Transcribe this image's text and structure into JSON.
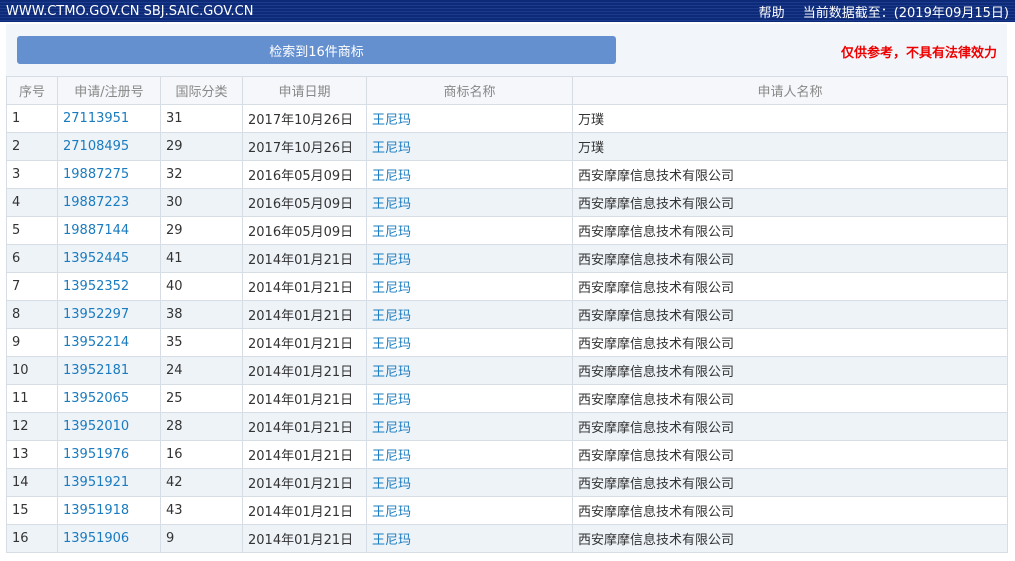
{
  "header": {
    "site": "WWW.CTMO.GOV.CN SBJ.SAIC.GOV.CN",
    "help": "帮助",
    "data_date": "当前数据截至：(2019年09月15日)"
  },
  "search_result": "检索到16件商标",
  "disclaimer": "仅供参考，不具有法律效力",
  "columns": [
    "序号",
    "申请/注册号",
    "国际分类",
    "申请日期",
    "商标名称",
    "申请人名称"
  ],
  "rows": [
    [
      "1",
      "27113951",
      "31",
      "2017年10月26日",
      "王尼玛",
      "万璞"
    ],
    [
      "2",
      "27108495",
      "29",
      "2017年10月26日",
      "王尼玛",
      "万璞"
    ],
    [
      "3",
      "19887275",
      "32",
      "2016年05月09日",
      "王尼玛",
      "西安摩摩信息技术有限公司"
    ],
    [
      "4",
      "19887223",
      "30",
      "2016年05月09日",
      "王尼玛",
      "西安摩摩信息技术有限公司"
    ],
    [
      "5",
      "19887144",
      "29",
      "2016年05月09日",
      "王尼玛",
      "西安摩摩信息技术有限公司"
    ],
    [
      "6",
      "13952445",
      "41",
      "2014年01月21日",
      "王尼玛",
      "西安摩摩信息技术有限公司"
    ],
    [
      "7",
      "13952352",
      "40",
      "2014年01月21日",
      "王尼玛",
      "西安摩摩信息技术有限公司"
    ],
    [
      "8",
      "13952297",
      "38",
      "2014年01月21日",
      "王尼玛",
      "西安摩摩信息技术有限公司"
    ],
    [
      "9",
      "13952214",
      "35",
      "2014年01月21日",
      "王尼玛",
      "西安摩摩信息技术有限公司"
    ],
    [
      "10",
      "13952181",
      "24",
      "2014年01月21日",
      "王尼玛",
      "西安摩摩信息技术有限公司"
    ],
    [
      "11",
      "13952065",
      "25",
      "2014年01月21日",
      "王尼玛",
      "西安摩摩信息技术有限公司"
    ],
    [
      "12",
      "13952010",
      "28",
      "2014年01月21日",
      "王尼玛",
      "西安摩摩信息技术有限公司"
    ],
    [
      "13",
      "13951976",
      "16",
      "2014年01月21日",
      "王尼玛",
      "西安摩摩信息技术有限公司"
    ],
    [
      "14",
      "13951921",
      "42",
      "2014年01月21日",
      "王尼玛",
      "西安摩摩信息技术有限公司"
    ],
    [
      "15",
      "13951918",
      "43",
      "2014年01月21日",
      "王尼玛",
      "西安摩摩信息技术有限公司"
    ],
    [
      "16",
      "13951906",
      "9",
      "2014年01月21日",
      "王尼玛",
      "西安摩摩信息技术有限公司"
    ]
  ]
}
